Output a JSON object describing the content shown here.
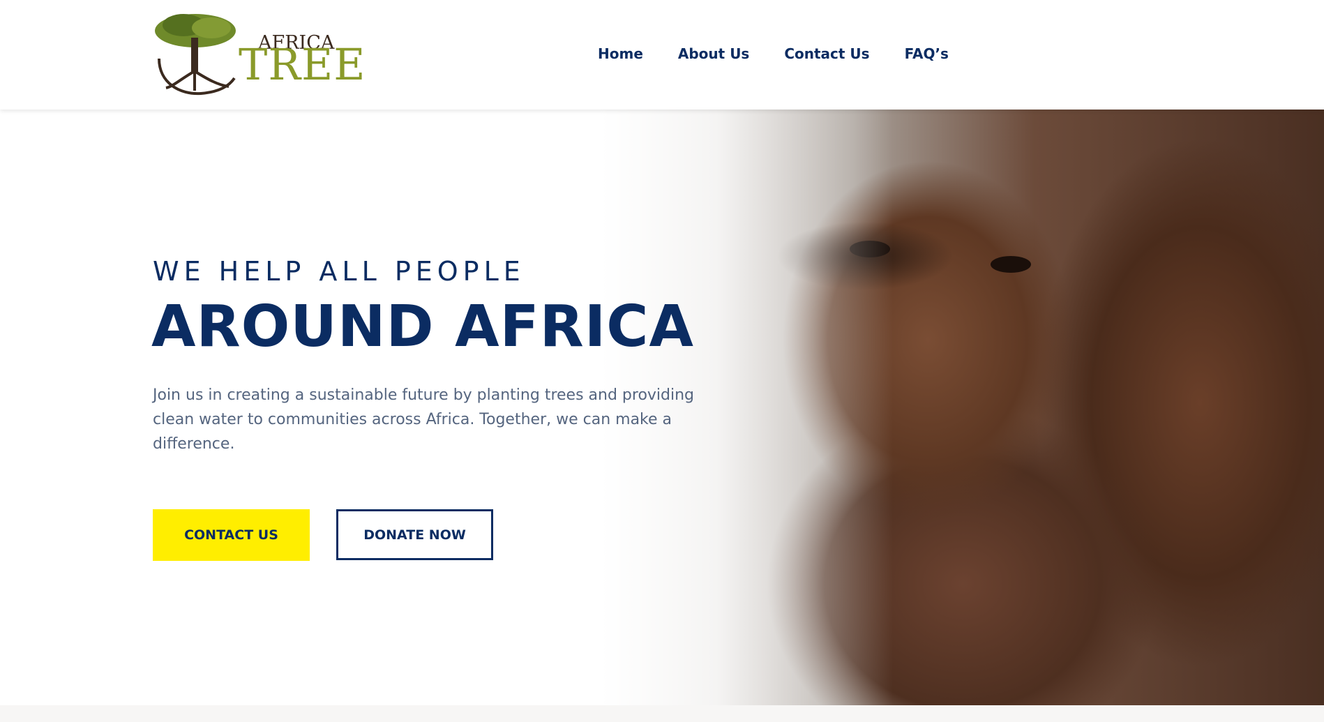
{
  "logo": {
    "word_top": "AFRICA",
    "word_main": "TREE"
  },
  "nav": {
    "items": [
      {
        "label": "Home"
      },
      {
        "label": "About Us"
      },
      {
        "label": "Contact Us"
      },
      {
        "label": "FAQ’s"
      }
    ]
  },
  "hero": {
    "eyebrow": "WE HELP ALL PEOPLE",
    "headline": "AROUND AFRICA",
    "lead": "Join us in creating a sustainable future by planting trees and providing clean water to communities across Africa. Together, we can make a difference.",
    "primary_button": "CONTACT US",
    "secondary_button": "DONATE NOW"
  },
  "colors": {
    "brand_navy": "#0b2c62",
    "accent_yellow": "#ffee00",
    "logo_green": "#8a9a2a",
    "logo_brown": "#3b2a1f"
  }
}
